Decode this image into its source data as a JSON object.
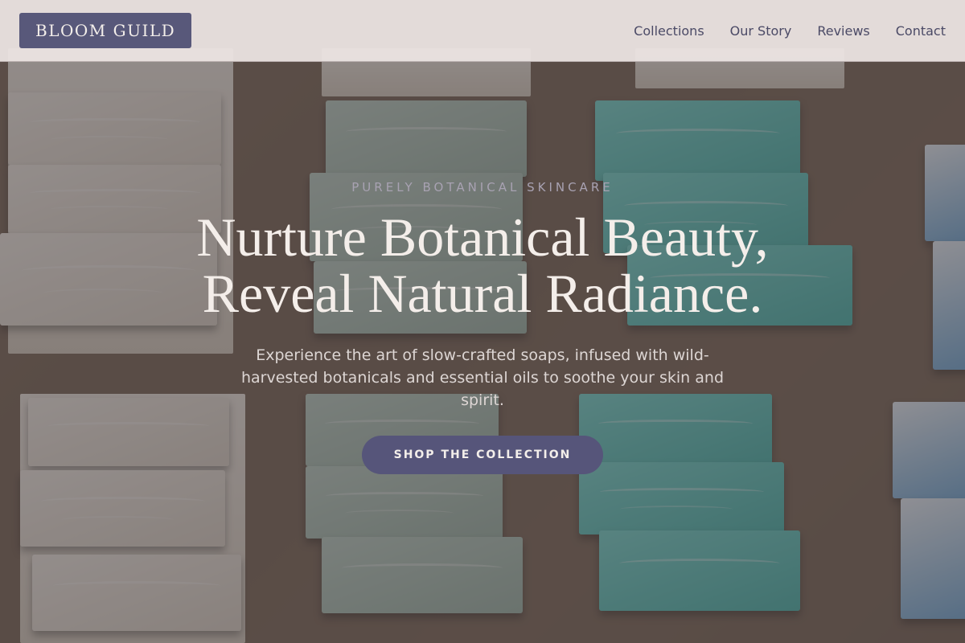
{
  "brand": {
    "name": "BLOOM GUILD"
  },
  "nav": {
    "links": [
      {
        "label": "Collections"
      },
      {
        "label": "Our Story"
      },
      {
        "label": "Reviews"
      },
      {
        "label": "Contact"
      }
    ]
  },
  "hero": {
    "eyebrow": "PURELY BOTANICAL SKINCARE",
    "headline_line1": "Nurture Botanical Beauty,",
    "headline_line2": "Reveal Natural Radiance.",
    "subtext": "Experience the art of slow-crafted soaps, infused with wild-harvested botanicals and essential oils to soothe your skin and spirit.",
    "cta_label": "SHOP THE COLLECTION"
  },
  "colors": {
    "accent": "#56557a",
    "nav_background": "#ece4e2",
    "headline": "#f4eeea"
  }
}
